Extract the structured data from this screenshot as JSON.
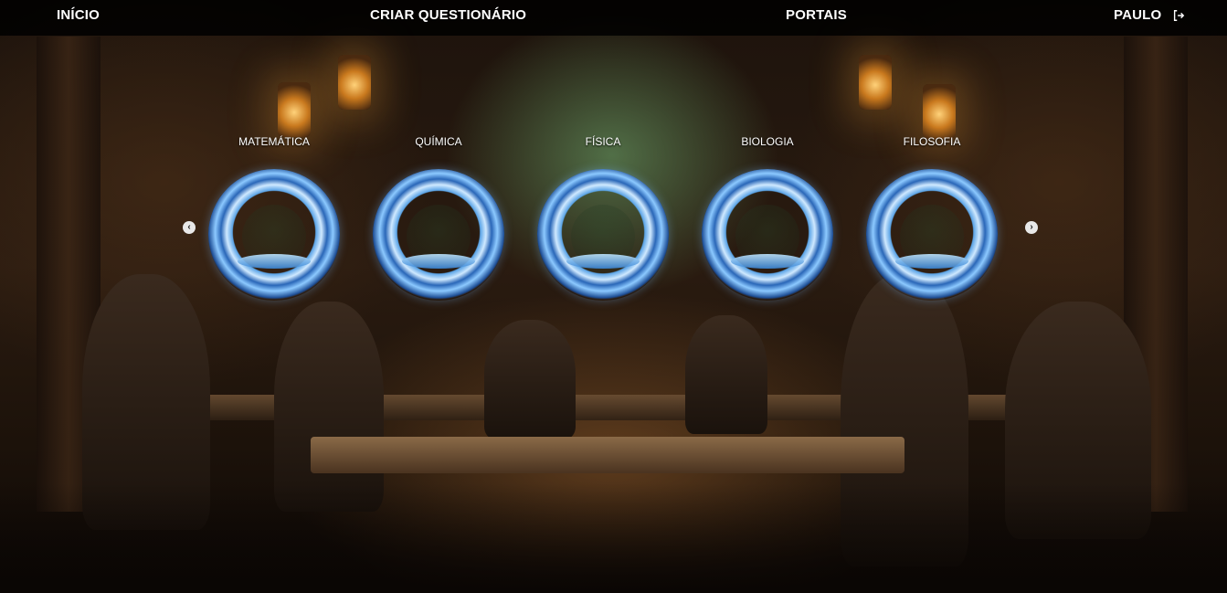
{
  "nav": {
    "home_label": "INÍCIO",
    "create_quiz_label": "CRIAR QUESTIONÁRIO",
    "portals_label": "PORTAIS",
    "user_name": "PAULO",
    "logout_icon": "logout-icon"
  },
  "carousel": {
    "prev_icon": "chevron-left-icon",
    "next_icon": "chevron-right-icon",
    "prev_glyph": "‹",
    "next_glyph": "›",
    "items": [
      {
        "label": "MATEMÁTICA"
      },
      {
        "label": "QUÍMICA"
      },
      {
        "label": "FÍSICA"
      },
      {
        "label": "BIOLOGIA"
      },
      {
        "label": "FILOSOFIA"
      }
    ]
  },
  "colors": {
    "navbar_bg": "#000000",
    "portal_ice": "#5aa3e6",
    "text": "#ffffff"
  }
}
